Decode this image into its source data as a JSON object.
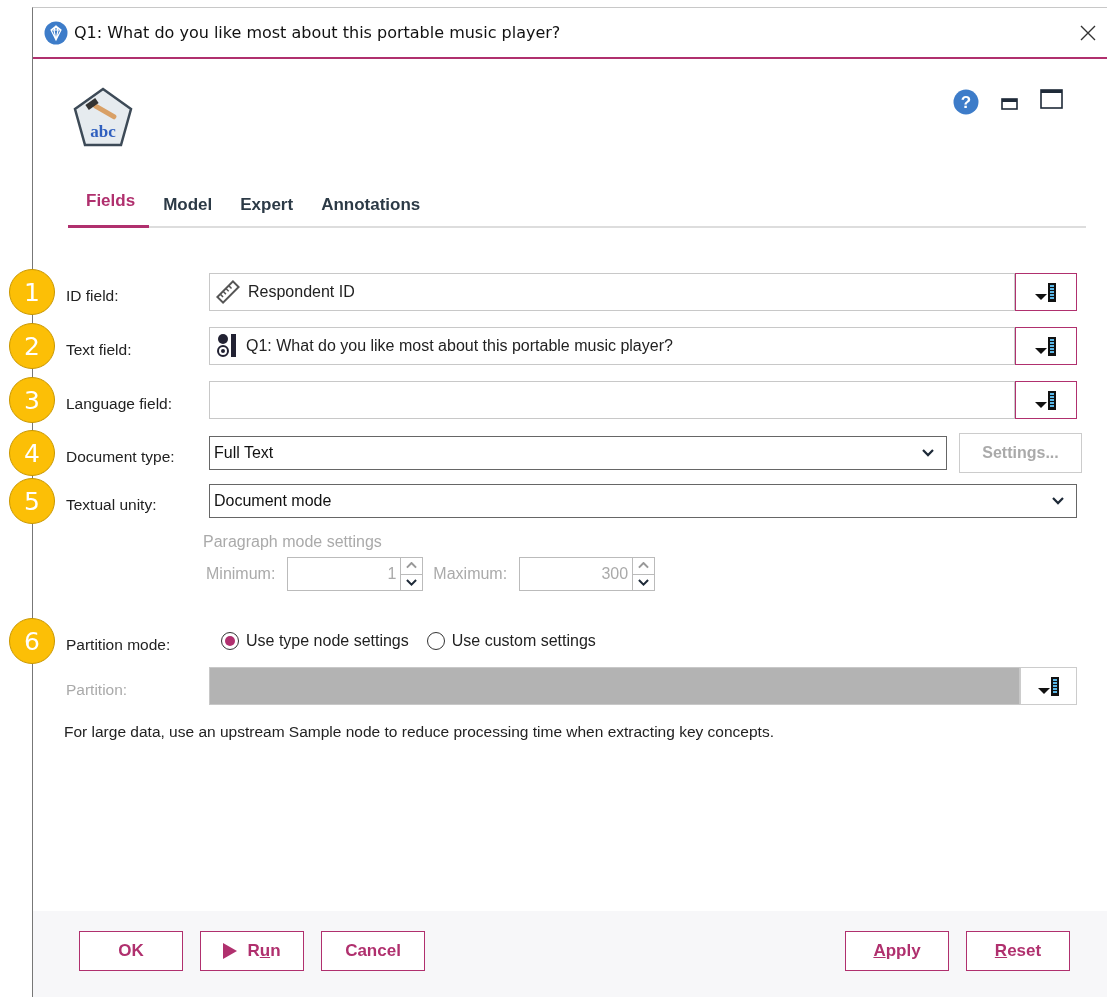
{
  "window": {
    "title": "Q1: What do you like most about this portable music player?"
  },
  "header": {
    "node_icon_text": "abc",
    "help_text": "?"
  },
  "tabs": [
    {
      "label": "Fields",
      "selected": true
    },
    {
      "label": "Model",
      "selected": false
    },
    {
      "label": "Expert",
      "selected": false
    },
    {
      "label": "Annotations",
      "selected": false
    }
  ],
  "fields": [
    {
      "marker": "1",
      "label": "ID field:",
      "kind": "continuous_picker",
      "value": "Respondent ID"
    },
    {
      "marker": "2",
      "label": "Text field:",
      "kind": "nominal_picker",
      "value": "Q1: What do you like most about this portable music player?"
    },
    {
      "marker": "3",
      "label": "Language field:",
      "kind": "picker"
    },
    {
      "marker": "4",
      "label": "Document type:",
      "kind": "dropdown",
      "value": "Full Text",
      "button": {
        "label": "Settings...",
        "disabled": true
      }
    },
    {
      "marker": "5",
      "label": "Textual unity:",
      "kind": "dropdown",
      "value": "Document mode"
    }
  ],
  "paragraph_mode": {
    "title": "Paragraph mode settings",
    "disabled": true,
    "minimum": {
      "label": "Minimum:",
      "value": "1"
    },
    "maximum": {
      "label": "Maximum:",
      "value": "300"
    }
  },
  "partition_mode": {
    "marker": "6",
    "label": "Partition mode:",
    "options": [
      {
        "label": "Use type node settings",
        "selected": true
      },
      {
        "label": "Use custom settings",
        "selected": false
      }
    ]
  },
  "partition": {
    "label": "Partition:",
    "disabled": true
  },
  "note": "For large data, use an upstream Sample node to reduce processing time when extracting key concepts.",
  "footer": {
    "left_buttons": [
      {
        "kind": "plain",
        "before": "OK"
      },
      {
        "kind": "run",
        "before": "R",
        "key": "u",
        "after": "n"
      },
      {
        "kind": "plain",
        "before": "Cancel"
      }
    ],
    "right_buttons": [
      {
        "key": "A",
        "after": "pply"
      },
      {
        "key": "R",
        "after": "eset"
      }
    ]
  }
}
